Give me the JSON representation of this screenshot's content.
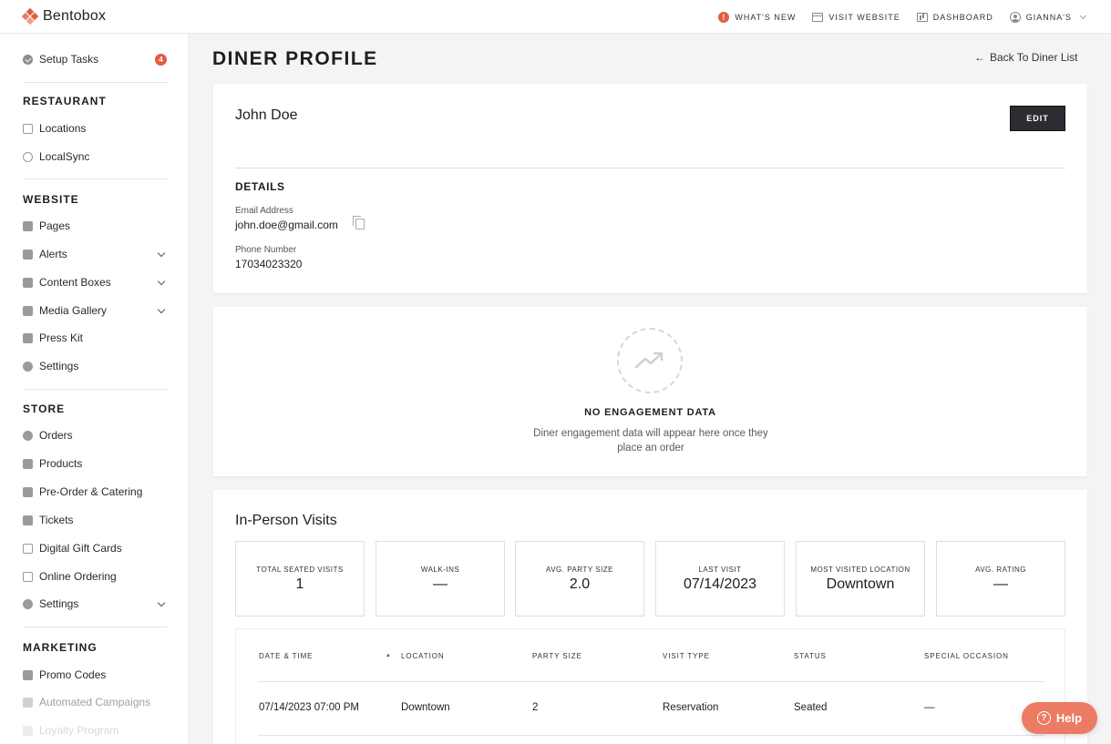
{
  "app": {
    "name": "Bentobox"
  },
  "topnav": {
    "whats_new_badge": "!",
    "whats_new": "WHAT'S NEW",
    "visit_website": "VISIT WEBSITE",
    "dashboard": "DASHBOARD",
    "user": "GIANNA'S"
  },
  "sidebar": {
    "setup_tasks": {
      "label": "Setup Tasks",
      "badge": "4"
    },
    "sections": {
      "restaurant": "RESTAURANT",
      "website": "WEBSITE",
      "store": "STORE",
      "marketing": "MARKETING"
    },
    "restaurant_items": [
      "Locations",
      "LocalSync"
    ],
    "website_items": [
      "Pages",
      "Alerts",
      "Content Boxes",
      "Media Gallery",
      "Press Kit",
      "Settings"
    ],
    "store_items": [
      "Orders",
      "Products",
      "Pre-Order & Catering",
      "Tickets",
      "Digital Gift Cards",
      "Online Ordering",
      "Settings"
    ],
    "marketing_items": [
      "Promo Codes",
      "Automated Campaigns",
      "Loyalty Program"
    ]
  },
  "page": {
    "title": "DINER PROFILE",
    "back_link": "Back To Diner List"
  },
  "profile": {
    "name": "John Doe",
    "edit_label": "EDIT",
    "details_heading": "DETAILS",
    "email_label": "Email Address",
    "email": "john.doe@gmail.com",
    "phone_label": "Phone Number",
    "phone": "17034023320"
  },
  "engagement": {
    "title": "NO ENGAGEMENT DATA",
    "description": "Diner engagement data will appear here once they place an order"
  },
  "visits": {
    "title": "In-Person Visits",
    "stats": [
      {
        "label": "TOTAL SEATED VISITS",
        "value": "1"
      },
      {
        "label": "WALK-INS",
        "value": "—"
      },
      {
        "label": "AVG. PARTY SIZE",
        "value": "2.0"
      },
      {
        "label": "LAST VISIT",
        "value": "07/14/2023"
      },
      {
        "label": "MOST VISITED LOCATION",
        "value": "Downtown"
      },
      {
        "label": "AVG. RATING",
        "value": "—"
      }
    ],
    "columns": [
      "DATE & TIME",
      "LOCATION",
      "PARTY SIZE",
      "VISIT TYPE",
      "STATUS",
      "SPECIAL OCCASION"
    ],
    "rows": [
      [
        "07/14/2023 07:00 PM",
        "Downtown",
        "2",
        "Reservation",
        "Seated",
        "—"
      ]
    ]
  },
  "help": {
    "label": "Help"
  },
  "colors": {
    "accent": "#e45b3d",
    "help_button": "#ec7b63",
    "edit_button": "#2b2d33"
  }
}
